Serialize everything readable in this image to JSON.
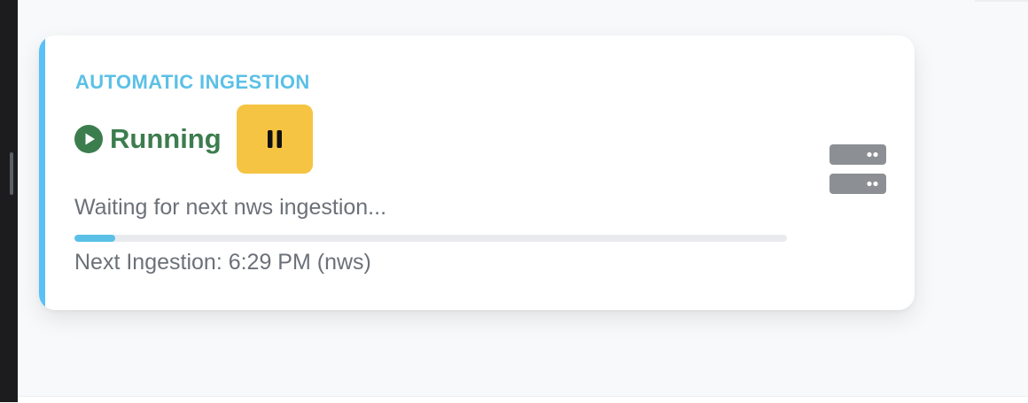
{
  "ingestion_card": {
    "title": "AUTOMATIC INGESTION",
    "status": {
      "label": "Running",
      "icon": "play-circle-icon",
      "color": "#3c7d4e"
    },
    "pause_button": {
      "icon": "pause-icon",
      "color": "#f5c443"
    },
    "message": "Waiting for next nws ingestion...",
    "progress_fraction": 0.057,
    "next_ingestion": "Next Ingestion: 6:29 PM (nws)",
    "source_icon": "server-icon",
    "accent_color": "#5bc0f8"
  }
}
